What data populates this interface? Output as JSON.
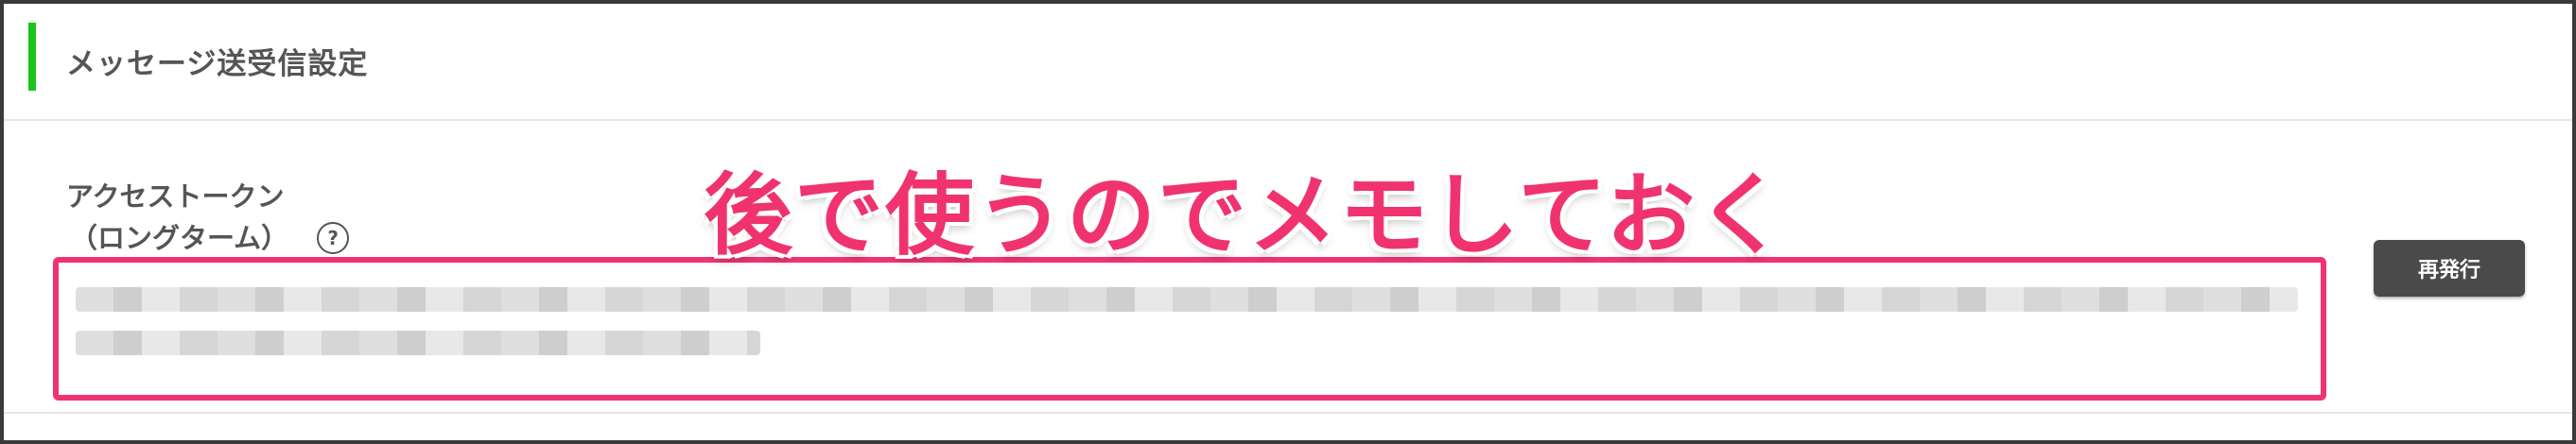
{
  "section": {
    "title": "メッセージ送受信設定"
  },
  "token": {
    "label_line1": "アクセストークン",
    "label_line2": "（ロングターム）",
    "help_symbol": "?"
  },
  "annotation": {
    "text": "後で使うのでメモしておく",
    "color": "#f0336f"
  },
  "actions": {
    "reissue_label": "再発行"
  },
  "colors": {
    "accent": "#19c519",
    "button_bg": "#4a4a4a"
  }
}
